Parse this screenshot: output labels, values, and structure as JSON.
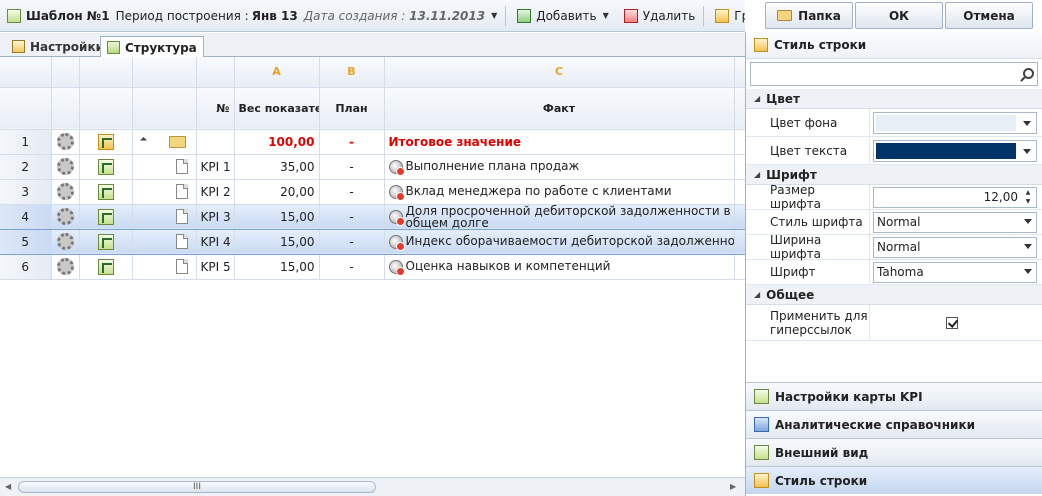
{
  "toolbar": {
    "title": "Шаблон №1",
    "period_label": "Период построения :",
    "period_value": "Янв 13",
    "created_label": "Дата создания :",
    "created_value": "13.11.2013",
    "add_label": "Добавить",
    "delete_label": "Удалить",
    "group_label": "Группа\\элемент"
  },
  "top_buttons": {
    "folder": "Папка",
    "ok": "ОК",
    "cancel": "Отмена"
  },
  "tabs": [
    {
      "label": "Настройки"
    },
    {
      "label": "Структура",
      "active": true
    }
  ],
  "grid": {
    "col_letters": [
      "A",
      "B",
      "C"
    ],
    "headers": {
      "num": "№",
      "weight": "Вес показателя",
      "plan": "План",
      "fact": "Факт"
    },
    "rows": [
      {
        "n": "1",
        "code": "",
        "weight": "100,00",
        "plan": "-",
        "fact": "Итоговое значение",
        "total": true
      },
      {
        "n": "2",
        "code": "KPI 1",
        "weight": "35,00",
        "plan": "-",
        "fact": "Выполнение плана продаж"
      },
      {
        "n": "3",
        "code": "KPI 2",
        "weight": "20,00",
        "plan": "-",
        "fact": "Вклад менеджера по работе с клиентами"
      },
      {
        "n": "4",
        "code": "KPI 3",
        "weight": "15,00",
        "plan": "-",
        "fact": "Доля просроченной дебиторской задолженности в общем долге",
        "selected": true
      },
      {
        "n": "5",
        "code": "KPI 4",
        "weight": "15,00",
        "plan": "-",
        "fact": "Индекс оборачиваемости дебиторской задолженности",
        "selected": true
      },
      {
        "n": "6",
        "code": "KPI 5",
        "weight": "15,00",
        "plan": "-",
        "fact": "Оценка навыков и компетенций"
      }
    ]
  },
  "scrollbar": {
    "thumb_grip": "III"
  },
  "right_panel": {
    "title": "Стиль строки",
    "search": {
      "value": ""
    },
    "sections": {
      "color": {
        "title": "Цвет",
        "bg_label": "Цвет фона",
        "bg_color": "#e8eef5",
        "text_label": "Цвет текста",
        "text_color": "#003366"
      },
      "font": {
        "title": "Шрифт",
        "size_label": "Размер шрифта",
        "size_value": "12,00",
        "style_label": "Стиль шрифта",
        "style_value": "Normal",
        "width_label": "Ширина шрифта",
        "width_value": "Normal",
        "font_label": "Шрифт",
        "font_value": "Tahoma"
      },
      "general": {
        "title": "Общее",
        "hyperlink_label": "Применить для гиперссылок",
        "hyperlink_checked": true
      }
    },
    "accordion": [
      {
        "label": "Настройки карты KPI"
      },
      {
        "label": "Аналитические справочники"
      },
      {
        "label": "Внешний вид"
      },
      {
        "label": "Стиль строки",
        "active": true
      }
    ]
  }
}
